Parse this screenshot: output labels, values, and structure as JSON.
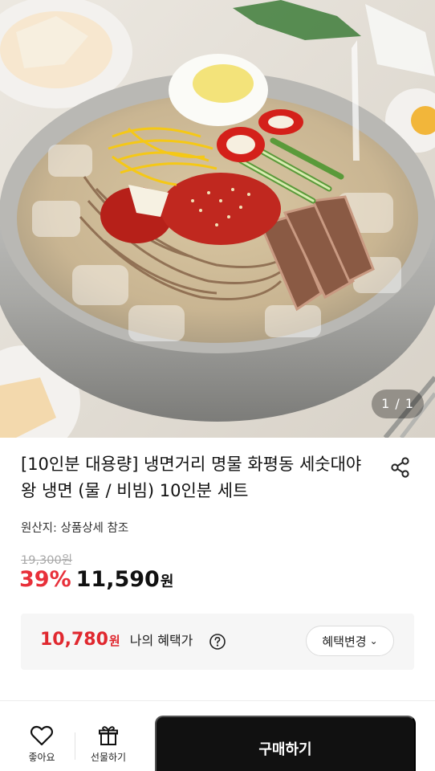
{
  "gallery": {
    "counter": "1 / 1",
    "image_alt": "naengmyeon bowl"
  },
  "product": {
    "title": "[10인분 대용량] 냉면거리 명물 화평동 세숫대야 왕 냉면 (물 / 비빔) 10인분 세트",
    "origin": "원산지: 상품상세 참조",
    "original_price": "19,300원",
    "discount": "39%",
    "sale_price": "11,590",
    "sale_unit": "원"
  },
  "benefit": {
    "price": "10,780",
    "unit": "원",
    "label": "나의 혜택가",
    "change_label": "혜택변경",
    "chevron": "⌄"
  },
  "bottom_bar": {
    "like_label": "좋아요",
    "gift_label": "선물하기",
    "buy_label": "구매하기"
  },
  "colors": {
    "accent_red": "#e8303a",
    "buy_button": "#111111",
    "benefit_bg": "#f6f6f6"
  },
  "icons": [
    "share-icon",
    "help-icon",
    "heart-icon",
    "gift-icon",
    "chevron-down-icon"
  ]
}
